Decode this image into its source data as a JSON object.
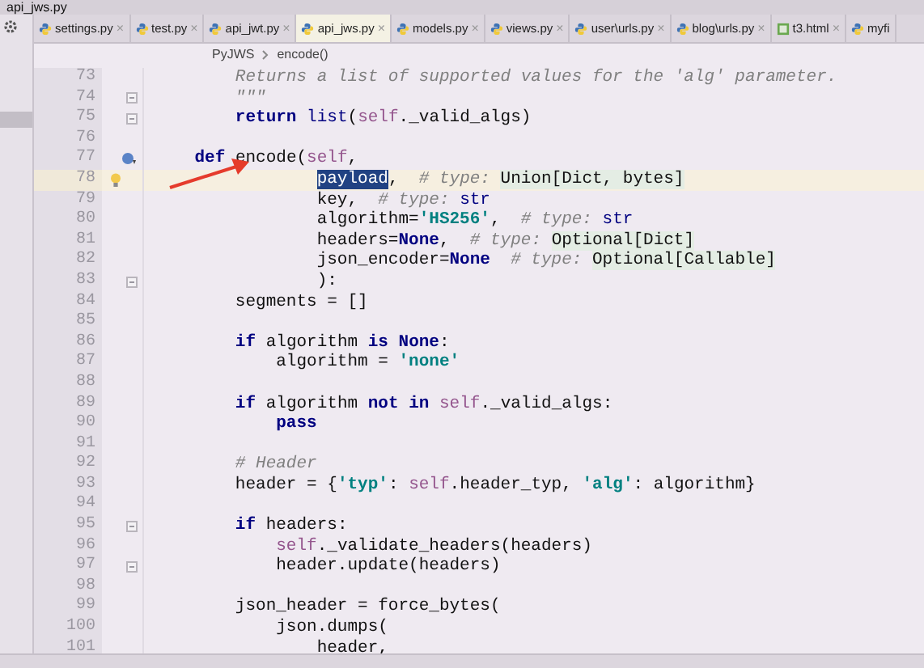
{
  "window": {
    "title": "api_jws.py"
  },
  "tabs": [
    {
      "label": "settings.py",
      "kind": "py",
      "selected": false,
      "close": "×"
    },
    {
      "label": "test.py",
      "kind": "py",
      "selected": false,
      "close": "×"
    },
    {
      "label": "api_jwt.py",
      "kind": "py",
      "selected": false,
      "close": "×"
    },
    {
      "label": "api_jws.py",
      "kind": "py",
      "selected": true,
      "close": "×"
    },
    {
      "label": "models.py",
      "kind": "py",
      "selected": false,
      "close": "×"
    },
    {
      "label": "views.py",
      "kind": "py",
      "selected": false,
      "close": "×"
    },
    {
      "label": "user\\urls.py",
      "kind": "py",
      "selected": false,
      "close": "×"
    },
    {
      "label": "blog\\urls.py",
      "kind": "py",
      "selected": false,
      "close": "×"
    },
    {
      "label": "t3.html",
      "kind": "html",
      "selected": false,
      "close": "×"
    },
    {
      "label": "myfi",
      "kind": "py",
      "selected": false
    }
  ],
  "breadcrumb": [
    "PyJWS",
    "encode()"
  ],
  "lines": [
    {
      "n": "73",
      "current": false,
      "fold": false,
      "override": false,
      "bulb": false,
      "tokens": [
        {
          "kind": "doc",
          "t": "        Returns a list of supported values for the 'alg' parameter."
        }
      ]
    },
    {
      "n": "74",
      "current": false,
      "fold": true,
      "override": false,
      "bulb": false,
      "tokens": [
        {
          "kind": "doc",
          "t": "        \"\"\""
        }
      ]
    },
    {
      "n": "75",
      "current": false,
      "fold": true,
      "override": false,
      "bulb": false,
      "tokens": [
        {
          "kind": "kw",
          "t": "        return "
        },
        {
          "kind": "bi",
          "t": "list"
        },
        {
          "kind": "p",
          "t": "("
        },
        {
          "kind": "self",
          "t": "self"
        },
        {
          "kind": "p",
          "t": "._valid_algs)"
        }
      ]
    },
    {
      "n": "76",
      "current": false,
      "fold": false,
      "override": false,
      "bulb": false
    },
    {
      "n": "77",
      "current": false,
      "fold": false,
      "override": true,
      "bulb": false,
      "tokens": [
        {
          "kind": "kw",
          "t": "    def"
        },
        {
          "kind": "p",
          "t": " encode("
        },
        {
          "kind": "self",
          "t": "self"
        },
        {
          "kind": "p",
          "t": ","
        }
      ]
    },
    {
      "n": "78",
      "current": true,
      "fold": false,
      "override": false,
      "bulb": true,
      "tokens": [
        {
          "kind": "sel",
          "t": "                payload"
        },
        {
          "kind": "p",
          "t": ",  "
        },
        {
          "kind": "hint",
          "t": "# type: "
        },
        {
          "kind": "tp",
          "t": "Union[Dict, bytes]"
        }
      ]
    },
    {
      "n": "79",
      "current": false,
      "fold": false,
      "override": false,
      "bulb": false,
      "tokens": [
        {
          "kind": "p",
          "t": "                key,  "
        },
        {
          "kind": "hint",
          "t": "# type: "
        },
        {
          "kind": "bi",
          "t": "str"
        }
      ]
    },
    {
      "n": "80",
      "current": false,
      "fold": false,
      "override": false,
      "bulb": false,
      "tokens": [
        {
          "kind": "p",
          "t": "                algorithm="
        },
        {
          "kind": "str",
          "t": "'HS256'"
        },
        {
          "kind": "p",
          "t": ",  "
        },
        {
          "kind": "hint",
          "t": "# type: "
        },
        {
          "kind": "bi",
          "t": "str"
        }
      ]
    },
    {
      "n": "81",
      "current": false,
      "fold": false,
      "override": false,
      "bulb": false,
      "tokens": [
        {
          "kind": "p",
          "t": "                headers="
        },
        {
          "kind": "kw",
          "t": "None"
        },
        {
          "kind": "p",
          "t": ",  "
        },
        {
          "kind": "hint",
          "t": "# type: "
        },
        {
          "kind": "tp",
          "t": "Optional[Dict]"
        }
      ]
    },
    {
      "n": "82",
      "current": false,
      "fold": false,
      "override": false,
      "bulb": false,
      "tokens": [
        {
          "kind": "p",
          "t": "                json_encoder="
        },
        {
          "kind": "kw",
          "t": "None  "
        },
        {
          "kind": "hint",
          "t": "# type: "
        },
        {
          "kind": "tp",
          "t": "Optional[Callable]"
        }
      ]
    },
    {
      "n": "83",
      "current": false,
      "fold": true,
      "override": false,
      "bulb": false,
      "tokens": [
        {
          "kind": "p",
          "t": "                ):"
        }
      ]
    },
    {
      "n": "84",
      "current": false,
      "fold": false,
      "override": false,
      "bulb": false,
      "tokens": [
        {
          "kind": "p",
          "t": "        segments = []"
        }
      ]
    },
    {
      "n": "85",
      "current": false,
      "fold": false,
      "override": false,
      "bulb": false
    },
    {
      "n": "86",
      "current": false,
      "fold": false,
      "override": false,
      "bulb": false,
      "tokens": [
        {
          "kind": "kw",
          "t": "        if"
        },
        {
          "kind": "p",
          "t": " algorithm "
        },
        {
          "kind": "kw",
          "t": "is None"
        },
        {
          "kind": "p",
          "t": ":"
        }
      ]
    },
    {
      "n": "87",
      "current": false,
      "fold": false,
      "override": false,
      "bulb": false,
      "tokens": [
        {
          "kind": "p",
          "t": "            algorithm = "
        },
        {
          "kind": "str",
          "t": "'none'"
        }
      ]
    },
    {
      "n": "88",
      "current": false,
      "fold": false,
      "override": false,
      "bulb": false
    },
    {
      "n": "89",
      "current": false,
      "fold": false,
      "override": false,
      "bulb": false,
      "tokens": [
        {
          "kind": "kw",
          "t": "        if"
        },
        {
          "kind": "p",
          "t": " algorithm "
        },
        {
          "kind": "kw",
          "t": "not in "
        },
        {
          "kind": "self",
          "t": "self"
        },
        {
          "kind": "p",
          "t": "._valid_algs:"
        }
      ]
    },
    {
      "n": "90",
      "current": false,
      "fold": false,
      "override": false,
      "bulb": false,
      "tokens": [
        {
          "kind": "kw",
          "t": "            pass"
        }
      ]
    },
    {
      "n": "91",
      "current": false,
      "fold": false,
      "override": false,
      "bulb": false
    },
    {
      "n": "92",
      "current": false,
      "fold": false,
      "override": false,
      "bulb": false,
      "tokens": [
        {
          "kind": "cm",
          "t": "        # Header"
        }
      ]
    },
    {
      "n": "93",
      "current": false,
      "fold": false,
      "override": false,
      "bulb": false,
      "tokens": [
        {
          "kind": "p",
          "t": "        header = {"
        },
        {
          "kind": "str",
          "t": "'typ'"
        },
        {
          "kind": "p",
          "t": ": "
        },
        {
          "kind": "self",
          "t": "self"
        },
        {
          "kind": "p",
          "t": ".header_typ, "
        },
        {
          "kind": "str",
          "t": "'alg'"
        },
        {
          "kind": "p",
          "t": ": algorithm}"
        }
      ]
    },
    {
      "n": "94",
      "current": false,
      "fold": false,
      "override": false,
      "bulb": false
    },
    {
      "n": "95",
      "current": false,
      "fold": true,
      "override": false,
      "bulb": false,
      "tokens": [
        {
          "kind": "kw",
          "t": "        if"
        },
        {
          "kind": "p",
          "t": " headers:"
        }
      ]
    },
    {
      "n": "96",
      "current": false,
      "fold": false,
      "override": false,
      "bulb": false,
      "tokens": [
        {
          "kind": "self",
          "t": "            self"
        },
        {
          "kind": "p",
          "t": "._validate_headers(headers)"
        }
      ]
    },
    {
      "n": "97",
      "current": false,
      "fold": true,
      "override": false,
      "bulb": false,
      "tokens": [
        {
          "kind": "p",
          "t": "            header.update(headers)"
        }
      ]
    },
    {
      "n": "98",
      "current": false,
      "fold": false,
      "override": false,
      "bulb": false
    },
    {
      "n": "99",
      "current": false,
      "fold": false,
      "override": false,
      "bulb": false,
      "tokens": [
        {
          "kind": "p",
          "t": "        json_header = force_bytes("
        }
      ]
    },
    {
      "n": "100",
      "current": false,
      "fold": false,
      "override": false,
      "bulb": false,
      "tokens": [
        {
          "kind": "p",
          "t": "            json.dumps("
        }
      ]
    },
    {
      "n": "101",
      "current": false,
      "fold": false,
      "override": false,
      "bulb": false,
      "tokens": [
        {
          "kind": "p",
          "t": "                header,"
        }
      ]
    }
  ]
}
